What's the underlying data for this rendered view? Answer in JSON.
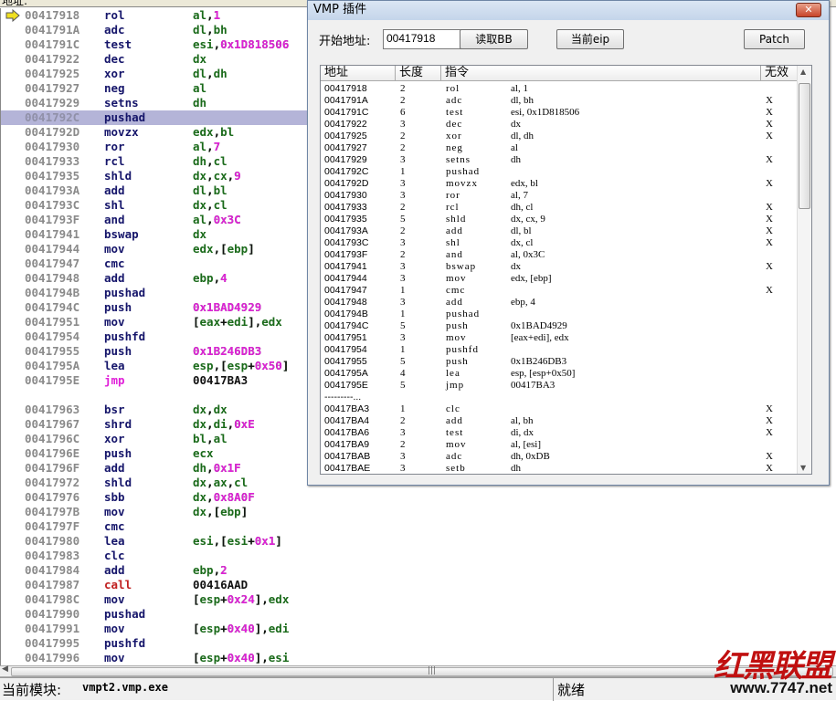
{
  "top_label": "地址:",
  "disasm": {
    "rows": [
      [
        "00417918",
        "rol",
        "al,1"
      ],
      [
        "0041791A",
        "adc",
        "dl,bh"
      ],
      [
        "0041791C",
        "test",
        "esi,0x1D818506"
      ],
      [
        "00417922",
        "dec",
        "dx"
      ],
      [
        "00417925",
        "xor",
        "dl,dh"
      ],
      [
        "00417927",
        "neg",
        "al"
      ],
      [
        "00417929",
        "setns",
        "dh"
      ],
      [
        "0041792C",
        "pushad",
        ""
      ],
      [
        "0041792D",
        "movzx",
        "edx,bl"
      ],
      [
        "00417930",
        "ror",
        "al,7"
      ],
      [
        "00417933",
        "rcl",
        "dh,cl"
      ],
      [
        "00417935",
        "shld",
        "dx,cx,9"
      ],
      [
        "0041793A",
        "add",
        "dl,bl"
      ],
      [
        "0041793C",
        "shl",
        "dx,cl"
      ],
      [
        "0041793F",
        "and",
        "al,0x3C"
      ],
      [
        "00417941",
        "bswap",
        "dx"
      ],
      [
        "00417944",
        "mov",
        "edx,[ebp]"
      ],
      [
        "00417947",
        "cmc",
        ""
      ],
      [
        "00417948",
        "add",
        "ebp,4"
      ],
      [
        "0041794B",
        "pushad",
        ""
      ],
      [
        "0041794C",
        "push",
        "0x1BAD4929"
      ],
      [
        "00417951",
        "mov",
        "[eax+edi],edx"
      ],
      [
        "00417954",
        "pushfd",
        ""
      ],
      [
        "00417955",
        "push",
        "0x1B246DB3"
      ],
      [
        "0041795A",
        "lea",
        "esp,[esp+0x50]"
      ],
      [
        "0041795E",
        "jmp",
        "00417BA3"
      ],
      null,
      [
        "00417963",
        "bsr",
        "dx,dx"
      ],
      [
        "00417967",
        "shrd",
        "dx,di,0xE"
      ],
      [
        "0041796C",
        "xor",
        "bl,al"
      ],
      [
        "0041796E",
        "push",
        "ecx"
      ],
      [
        "0041796F",
        "add",
        "dh,0x1F"
      ],
      [
        "00417972",
        "shld",
        "dx,ax,cl"
      ],
      [
        "00417976",
        "sbb",
        "dx,0x8A0F"
      ],
      [
        "0041797B",
        "mov",
        "dx,[ebp]"
      ],
      [
        "0041797F",
        "cmc",
        ""
      ],
      [
        "00417980",
        "lea",
        "esi,[esi+0x1]"
      ],
      [
        "00417983",
        "clc",
        ""
      ],
      [
        "00417984",
        "add",
        "ebp,2"
      ],
      [
        "00417987",
        "call",
        "00416AAD"
      ],
      [
        "0041798C",
        "mov",
        "[esp+0x24],edx"
      ],
      [
        "00417990",
        "pushad",
        ""
      ],
      [
        "00417991",
        "mov",
        "[esp+0x40],edi"
      ],
      [
        "00417995",
        "pushfd",
        ""
      ],
      [
        "00417996",
        "mov",
        "[esp+0x40],esi"
      ]
    ],
    "selected_index": 7,
    "current_index": 0,
    "colors": {
      "address": "#8a8a8a",
      "mnemonic": "#15156a",
      "register": "#1a6a1a",
      "number": "#e020d8",
      "jmp": "#e020d8",
      "call": "#c02020",
      "selection": "#b4b4d8"
    }
  },
  "dialog": {
    "title": "VMP 插件",
    "close_icon": "close-icon",
    "start_label": "开始地址:",
    "start_value": "00417918",
    "read_bb": "读取BB",
    "current_eip": "当前eip",
    "patch": "Patch",
    "columns": [
      "地址",
      "长度",
      "指令",
      "无效"
    ],
    "rows": [
      [
        "00417918",
        "2",
        "rol",
        "al, 1",
        ""
      ],
      [
        "0041791A",
        "2",
        "adc",
        "dl, bh",
        "X"
      ],
      [
        "0041791C",
        "6",
        "test",
        "esi, 0x1D818506",
        "X"
      ],
      [
        "00417922",
        "3",
        "dec",
        "dx",
        "X"
      ],
      [
        "00417925",
        "2",
        "xor",
        "dl, dh",
        "X"
      ],
      [
        "00417927",
        "2",
        "neg",
        "al",
        ""
      ],
      [
        "00417929",
        "3",
        "setns",
        "dh",
        "X"
      ],
      [
        "0041792C",
        "1",
        "pushad",
        "",
        ""
      ],
      [
        "0041792D",
        "3",
        "movzx",
        "edx, bl",
        "X"
      ],
      [
        "00417930",
        "3",
        "ror",
        "al, 7",
        ""
      ],
      [
        "00417933",
        "2",
        "rcl",
        "dh, cl",
        "X"
      ],
      [
        "00417935",
        "5",
        "shld",
        "dx, cx, 9",
        "X"
      ],
      [
        "0041793A",
        "2",
        "add",
        "dl, bl",
        "X"
      ],
      [
        "0041793C",
        "3",
        "shl",
        "dx, cl",
        "X"
      ],
      [
        "0041793F",
        "2",
        "and",
        "al, 0x3C",
        ""
      ],
      [
        "00417941",
        "3",
        "bswap",
        "dx",
        "X"
      ],
      [
        "00417944",
        "3",
        "mov",
        "edx, [ebp]",
        ""
      ],
      [
        "00417947",
        "1",
        "cmc",
        "",
        "X"
      ],
      [
        "00417948",
        "3",
        "add",
        "ebp, 4",
        ""
      ],
      [
        "0041794B",
        "1",
        "pushad",
        "",
        ""
      ],
      [
        "0041794C",
        "5",
        "push",
        "0x1BAD4929",
        ""
      ],
      [
        "00417951",
        "3",
        "mov",
        "[eax+edi], edx",
        ""
      ],
      [
        "00417954",
        "1",
        "pushfd",
        "",
        ""
      ],
      [
        "00417955",
        "5",
        "push",
        "0x1B246DB3",
        ""
      ],
      [
        "0041795A",
        "4",
        "lea",
        "esp, [esp+0x50]",
        ""
      ],
      [
        "0041795E",
        "5",
        "jmp",
        "00417BA3",
        ""
      ],
      [
        "---------...",
        "",
        "",
        "",
        ""
      ],
      [
        "00417BA3",
        "1",
        "clc",
        "",
        "X"
      ],
      [
        "00417BA4",
        "2",
        "add",
        "al, bh",
        "X"
      ],
      [
        "00417BA6",
        "3",
        "test",
        "di, dx",
        "X"
      ],
      [
        "00417BA9",
        "2",
        "mov",
        "al, [esi]",
        ""
      ],
      [
        "00417BAB",
        "3",
        "adc",
        "dh, 0xDB",
        "X"
      ],
      [
        "00417BAE",
        "3",
        "setb",
        "dh",
        "X"
      ]
    ]
  },
  "status": {
    "module_label": "当前模块:",
    "module_value": "vmpt2.vmp.exe",
    "state": "就绪"
  },
  "logo": {
    "text": "红黑联盟",
    "url": "www.7747.net"
  }
}
